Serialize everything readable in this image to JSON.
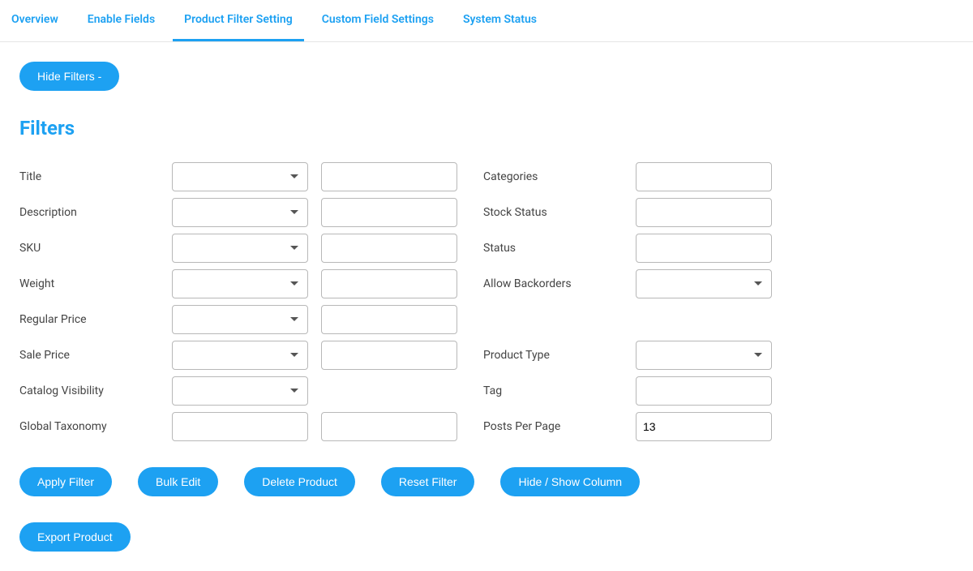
{
  "tabs": [
    {
      "label": "Overview"
    },
    {
      "label": "Enable Fields"
    },
    {
      "label": "Product Filter Setting"
    },
    {
      "label": "Custom Field Settings"
    },
    {
      "label": "System Status"
    }
  ],
  "toggle_filters_label": "Hide Filters -",
  "section_title": "Filters",
  "left_filters": [
    {
      "label": "Title",
      "has_select": true,
      "has_input": true
    },
    {
      "label": "Description",
      "has_select": true,
      "has_input": true
    },
    {
      "label": "SKU",
      "has_select": true,
      "has_input": true
    },
    {
      "label": "Weight",
      "has_select": true,
      "has_input": true
    },
    {
      "label": "Regular Price",
      "has_select": true,
      "has_input": true
    },
    {
      "label": "Sale Price",
      "has_select": true,
      "has_input": true
    },
    {
      "label": "Catalog Visibility",
      "has_select": true,
      "has_input": false
    },
    {
      "label": "Global Taxonomy",
      "has_two_inputs": true
    }
  ],
  "right_filters": [
    {
      "label": "Categories",
      "has_input": true
    },
    {
      "label": "Stock Status",
      "has_input": true
    },
    {
      "label": "Status",
      "has_input": true
    },
    {
      "label": "Allow Backorders",
      "has_select": true
    },
    {
      "label": "",
      "blank": true
    },
    {
      "label": "Product Type",
      "has_select": true
    },
    {
      "label": "Tag",
      "has_input": true
    },
    {
      "label": "Posts Per Page",
      "has_input": true,
      "value": "13"
    }
  ],
  "actions": [
    {
      "label": "Apply Filter"
    },
    {
      "label": "Bulk Edit"
    },
    {
      "label": "Delete Product"
    },
    {
      "label": "Reset Filter"
    },
    {
      "label": "Hide / Show Column"
    },
    {
      "label": "Export Product"
    }
  ]
}
